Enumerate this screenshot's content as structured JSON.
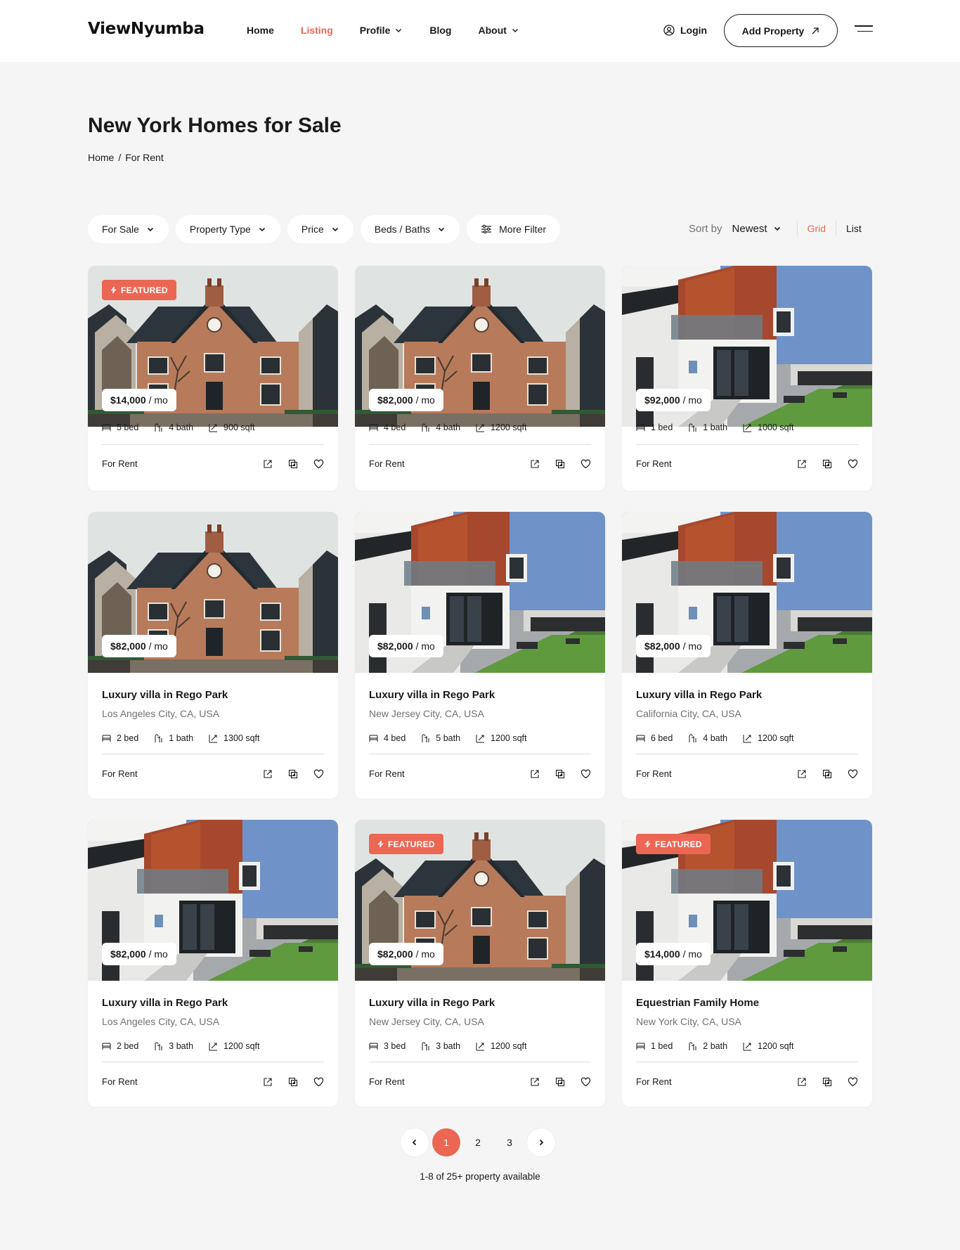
{
  "header": {
    "logo": "ViewNyumba",
    "nav": [
      {
        "label": "Home",
        "dropdown": false,
        "active": false
      },
      {
        "label": "Listing",
        "dropdown": false,
        "active": true
      },
      {
        "label": "Profile",
        "dropdown": true,
        "active": false
      },
      {
        "label": "Blog",
        "dropdown": false,
        "active": false
      },
      {
        "label": "About",
        "dropdown": true,
        "active": false
      }
    ],
    "login_label": "Login",
    "add_property_label": "Add Property"
  },
  "page": {
    "title": "New York Homes for Sale",
    "breadcrumb": [
      "Home",
      "For Rent"
    ]
  },
  "filters": {
    "buttons": [
      "For Sale",
      "Property Type",
      "Price",
      "Beds / Baths"
    ],
    "more_filter": "More Filter",
    "sort_label": "Sort by",
    "sort_value": "Newest",
    "view_grid": "Grid",
    "view_list": "List"
  },
  "colors": {
    "accent": "#eb6753",
    "background": "#f5f5f5"
  },
  "listings": [
    {
      "image": "brick",
      "featured": true,
      "price": "$14,000",
      "unit": "/ mo",
      "title": "",
      "location": "",
      "bed": "5 bed",
      "bath": "4 bath",
      "sqft": "900 sqft",
      "status": "For Rent"
    },
    {
      "image": "brick",
      "featured": false,
      "price": "$82,000",
      "unit": "/ mo",
      "title": "",
      "location": "",
      "bed": "4 bed",
      "bath": "4 bath",
      "sqft": "1200 sqft",
      "status": "For Rent"
    },
    {
      "image": "modern",
      "featured": false,
      "price": "$92,000",
      "unit": "/ mo",
      "title": "",
      "location": "",
      "bed": "1 bed",
      "bath": "1 bath",
      "sqft": "1000 sqft",
      "status": "For Rent"
    },
    {
      "image": "brick",
      "featured": false,
      "price": "$82,000",
      "unit": "/ mo",
      "title": "Luxury villa in Rego Park",
      "location": "Los Angeles City, CA, USA",
      "bed": "2 bed",
      "bath": "1 bath",
      "sqft": "1300 sqft",
      "status": "For Rent"
    },
    {
      "image": "modern",
      "featured": false,
      "price": "$82,000",
      "unit": "/ mo",
      "title": "Luxury villa in Rego Park",
      "location": "New Jersey City, CA, USA",
      "bed": "4 bed",
      "bath": "5 bath",
      "sqft": "1200 sqft",
      "status": "For Rent"
    },
    {
      "image": "modern",
      "featured": false,
      "price": "$82,000",
      "unit": "/ mo",
      "title": "Luxury villa in Rego Park",
      "location": "California City, CA, USA",
      "bed": "6 bed",
      "bath": "4 bath",
      "sqft": "1200 sqft",
      "status": "For Rent"
    },
    {
      "image": "modern",
      "featured": false,
      "price": "$82,000",
      "unit": "/ mo",
      "title": "Luxury villa in Rego Park",
      "location": "Los Angeles City, CA, USA",
      "bed": "2 bed",
      "bath": "3 bath",
      "sqft": "1200 sqft",
      "status": "For Rent"
    },
    {
      "image": "brick",
      "featured": true,
      "price": "$82,000",
      "unit": "/ mo",
      "title": "Luxury villa in Rego Park",
      "location": "New Jersey City, CA, USA",
      "bed": "3 bed",
      "bath": "3 bath",
      "sqft": "1200 sqft",
      "status": "For Rent"
    },
    {
      "image": "modern",
      "featured": true,
      "price": "$14,000",
      "unit": "/ mo",
      "title": "Equestrian Family Home",
      "location": "New York City, CA, USA",
      "bed": "1 bed",
      "bath": "2 bath",
      "sqft": "1200 sqft",
      "status": "For Rent"
    }
  ],
  "featured_label": "FEATURED",
  "pagination": {
    "pages": [
      "1",
      "2",
      "3"
    ],
    "current": "1",
    "summary": "1-8 of 25+ property available"
  }
}
